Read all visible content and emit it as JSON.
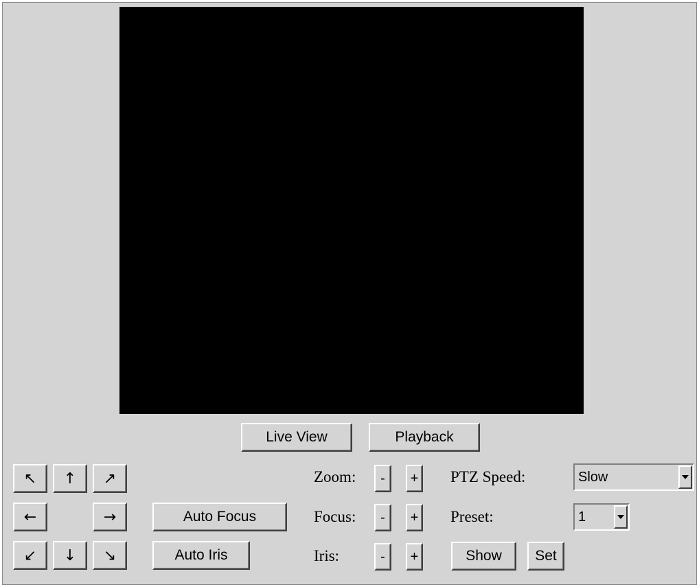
{
  "view_buttons": {
    "live_view": "Live View",
    "playback": "Playback"
  },
  "ptz_arrows": {
    "up_left": "↖",
    "up": "↑",
    "up_right": "↗",
    "left": "←",
    "right": "→",
    "down_left": "↙",
    "down": "↓",
    "down_right": "↘"
  },
  "auto_buttons": {
    "auto_focus": "Auto Focus",
    "auto_iris": "Auto Iris"
  },
  "lens": {
    "zoom_label": "Zoom:",
    "focus_label": "Focus:",
    "iris_label": "Iris:",
    "minus": "-",
    "plus": "+"
  },
  "ptz_speed": {
    "label": "PTZ Speed:",
    "value": "Slow"
  },
  "preset": {
    "label": "Preset:",
    "value": "1",
    "show_label": "Show",
    "set_label": "Set"
  }
}
